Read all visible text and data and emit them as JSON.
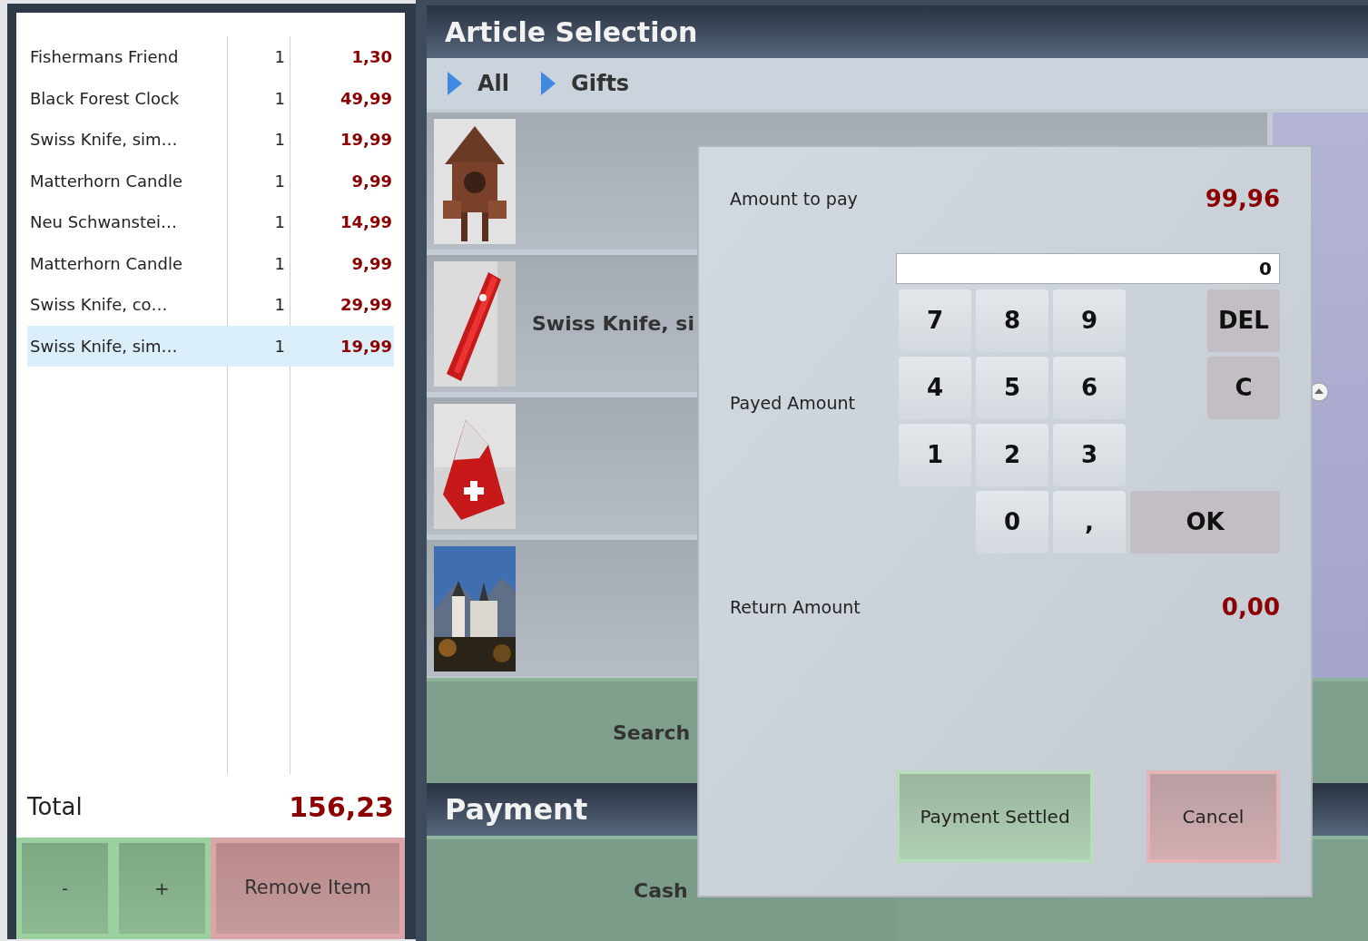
{
  "cart": {
    "rows": [
      {
        "name": "Fishermans Friend",
        "qty": "1",
        "price": "1,30",
        "selected": false
      },
      {
        "name": "Black Forest Clock",
        "qty": "1",
        "price": "49,99",
        "selected": false
      },
      {
        "name": "Swiss Knife, sim…",
        "qty": "1",
        "price": "19,99",
        "selected": false
      },
      {
        "name": "Matterhorn Candle",
        "qty": "1",
        "price": "9,99",
        "selected": false
      },
      {
        "name": "Neu Schwanstei…",
        "qty": "1",
        "price": "14,99",
        "selected": false
      },
      {
        "name": "Matterhorn Candle",
        "qty": "1",
        "price": "9,99",
        "selected": false
      },
      {
        "name": "Swiss Knife, co…",
        "qty": "1",
        "price": "29,99",
        "selected": false
      },
      {
        "name": "Swiss Knife, sim…",
        "qty": "1",
        "price": "19,99",
        "selected": true
      }
    ],
    "total_label": "Total",
    "total": "156,23",
    "buttons": [
      {
        "label": "-",
        "kind": "quantity"
      },
      {
        "label": "+",
        "kind": "quantity"
      },
      {
        "label": "Remove Item",
        "kind": "remove"
      }
    ]
  },
  "article_selection": {
    "title": "Article Selection",
    "categories": [
      {
        "label": "All"
      },
      {
        "label": "Gifts"
      }
    ],
    "articles": [
      {
        "kind": "clock"
      },
      {
        "kind": "knife",
        "label": "Swiss Knife, si"
      },
      {
        "kind": "candle"
      },
      {
        "kind": "castle"
      }
    ],
    "search": "Search"
  },
  "payment": {
    "title": "Payment",
    "methods": [
      {
        "label": "Cash"
      }
    ]
  },
  "dialog": {
    "amount_label": "Amount to pay",
    "amount": "99,96",
    "payed_label": "Payed Amount",
    "input_value": "0",
    "keys": [
      {
        "label": "7",
        "kind": "digit"
      },
      {
        "label": "8",
        "kind": "digit"
      },
      {
        "label": "9",
        "kind": "digit"
      },
      {
        "label": "DEL",
        "kind": "action"
      },
      {
        "label": "4",
        "kind": "digit"
      },
      {
        "label": "5",
        "kind": "digit"
      },
      {
        "label": "6",
        "kind": "digit"
      },
      {
        "label": "C",
        "kind": "action"
      },
      {
        "label": "1",
        "kind": "digit"
      },
      {
        "label": "2",
        "kind": "digit"
      },
      {
        "label": "3",
        "kind": "digit"
      },
      {
        "label": "0",
        "kind": "digit"
      },
      {
        "label": ",",
        "kind": "digit"
      },
      {
        "label": "OK",
        "kind": "action"
      }
    ],
    "return_label": "Return Amount",
    "return_amount": "0,00",
    "buttons": [
      {
        "label": "Payment Settled",
        "kind": "confirm"
      },
      {
        "label": "Cancel",
        "kind": "cancel"
      }
    ]
  }
}
